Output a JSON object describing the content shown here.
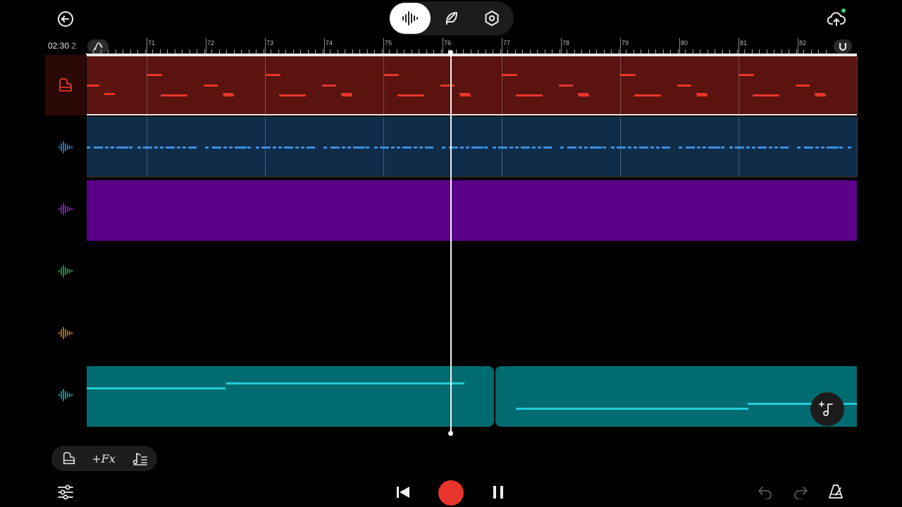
{
  "app": {
    "accent": "#ffffff"
  },
  "header": {
    "back_icon": "arrow-left-circle-icon",
    "modes": [
      {
        "name": "waveform-mode",
        "icon": "waveform-icon",
        "active": true
      },
      {
        "name": "feather-mode",
        "icon": "feather-icon",
        "active": false
      },
      {
        "name": "settings-mode",
        "icon": "hexagon-gear-icon",
        "active": false
      }
    ],
    "upload_icon": "cloud-upload-icon",
    "status_dot_color": "#3cd17a"
  },
  "timeline": {
    "time_main": "02:30",
    "time_frac": ".2",
    "bars": [
      "71",
      "72",
      "73",
      "74",
      "75",
      "76",
      "77",
      "78",
      "79",
      "80",
      "81",
      "82"
    ]
  },
  "tracks": [
    {
      "id": "piano",
      "icon": "piano-icon",
      "color": "#e8352b"
    },
    {
      "id": "drums",
      "icon": "waveform-icon",
      "color": "#3a8fe0"
    },
    {
      "id": "purple",
      "icon": "waveform-icon",
      "color": "#9b2bd6"
    },
    {
      "id": "green",
      "icon": "waveform-icon",
      "color": "#2cb56b"
    },
    {
      "id": "orange",
      "icon": "waveform-icon",
      "color": "#e08a2b"
    },
    {
      "id": "teal",
      "icon": "waveform-icon",
      "color": "#22b7bf"
    }
  ],
  "bottom_tools": {
    "fx_label": "+Fx"
  },
  "transport": {
    "rewind_icon": "skip-back-icon",
    "record_icon": "record-icon",
    "pause_icon": "pause-icon"
  }
}
